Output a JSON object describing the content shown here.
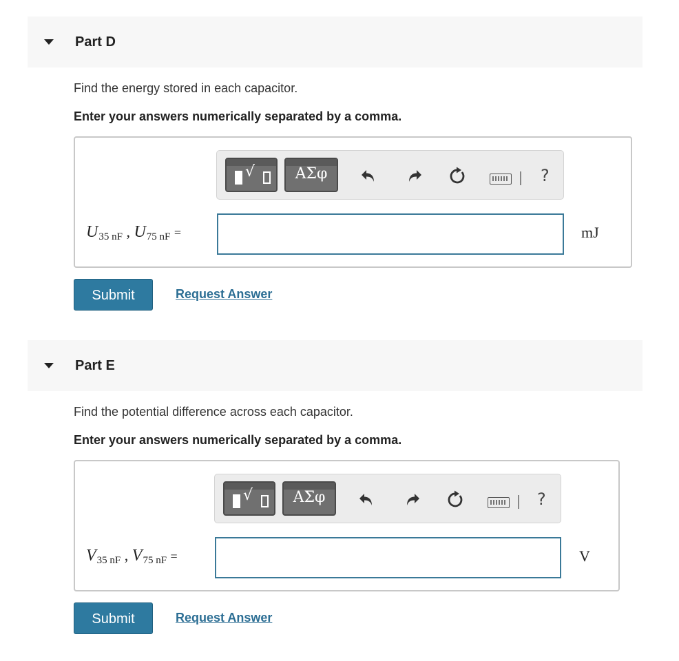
{
  "parts": [
    {
      "title": "Part D",
      "prompt": "Find the energy stored in each capacitor.",
      "instruction": "Enter your answers numerically separated by a comma.",
      "toolbar": {
        "greek_label": "ΑΣφ",
        "help_label": "?"
      },
      "answer": {
        "var1": "U",
        "sub1": "35 nF",
        "var2": "U",
        "sub2": "75 nF",
        "sep": ",",
        "eq": "=",
        "value": "",
        "unit": "mJ"
      },
      "submit_label": "Submit",
      "request_label": "Request Answer"
    },
    {
      "title": "Part E",
      "prompt": "Find the potential difference across each capacitor.",
      "instruction": "Enter your answers numerically separated by a comma.",
      "toolbar": {
        "greek_label": "ΑΣφ",
        "help_label": "?"
      },
      "answer": {
        "var1": "V",
        "sub1": "35 nF",
        "var2": "V",
        "sub2": "75 nF",
        "sep": ",",
        "eq": "=",
        "value": "",
        "unit": "V"
      },
      "submit_label": "Submit",
      "request_label": "Request Answer"
    }
  ],
  "icons": {
    "caret": "caret-down-icon",
    "template": "fraction-radical-template-icon",
    "undo": "undo-icon",
    "redo": "redo-icon",
    "reset": "reset-icon",
    "keyboard": "keyboard-icon",
    "help": "help-icon"
  },
  "colors": {
    "accent": "#2e7aa0",
    "link": "#2c6e94",
    "input_border": "#3a7998",
    "header_bg": "#f7f7f7"
  }
}
